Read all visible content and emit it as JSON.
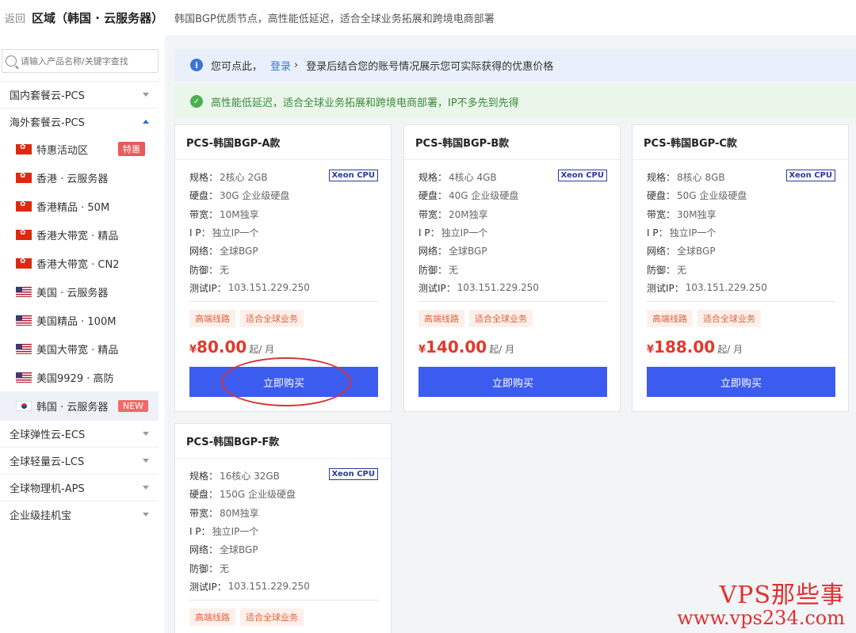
{
  "header": {
    "back_label": "返回",
    "title": "区域（韩国 · 云服务器）",
    "description": "韩国BGP优质节点，高性能低延迟，适合全球业务拓展和跨境电商部署"
  },
  "sidebar": {
    "search_placeholder": "请输入产品名称/关键字查找",
    "groups_top": [
      {
        "label": "国内套餐云-PCS",
        "expanded": false
      },
      {
        "label": "海外套餐云-PCS",
        "expanded": true
      }
    ],
    "sub_items": [
      {
        "label": "特惠活动区",
        "flag": "hk",
        "badge": "特惠"
      },
      {
        "label": "香港 · 云服务器",
        "flag": "hk"
      },
      {
        "label": "香港精品 · 50M",
        "flag": "hk"
      },
      {
        "label": "香港大带宽 · 精品",
        "flag": "hk"
      },
      {
        "label": "香港大带宽 · CN2",
        "flag": "hk"
      },
      {
        "label": "美国 · 云服务器",
        "flag": "us"
      },
      {
        "label": "美国精品 · 100M",
        "flag": "us"
      },
      {
        "label": "美国大带宽 · 精品",
        "flag": "us"
      },
      {
        "label": "美国9929 · 高防",
        "flag": "us"
      },
      {
        "label": "韩国 · 云服务器",
        "flag": "kr",
        "badge": "NEW",
        "active": true
      }
    ],
    "groups_bottom": [
      {
        "label": "全球弹性云-ECS"
      },
      {
        "label": "全球轻量云-LCS"
      },
      {
        "label": "全球物理机-APS"
      },
      {
        "label": "企业级挂机宝"
      }
    ]
  },
  "notices": {
    "info_prefix": "您可点此，",
    "login_link": "登录",
    "chevron": "›",
    "info_suffix": "登录后结合您的账号情况展示您可实际获得的优惠价格",
    "ok_text": "高性能低延迟，适合全球业务拓展和跨境电商部署，IP不多先到先得"
  },
  "labels": {
    "spec": "规格：",
    "disk": "硬盘：",
    "bandwidth": "带宽：",
    "ip": "I P：",
    "network": "网络：",
    "defense": "防御：",
    "test_ip": "测试IP：",
    "cpu_badge": "Xeon CPU",
    "tag1": "高端线路",
    "tag2": "适合全球业务",
    "currency": "¥",
    "unit": "起/ 月",
    "buy": "立即购买"
  },
  "products": [
    {
      "name": "PCS-韩国BGP-A款",
      "spec": "2核心 2GB",
      "disk": "30G 企业级硬盘",
      "bandwidth": "10M独享",
      "ip": "独立IP一个",
      "network": "全球BGP",
      "defense": "无",
      "test_ip": "103.151.229.250",
      "price": "80.00"
    },
    {
      "name": "PCS-韩国BGP-B款",
      "spec": "4核心 4GB",
      "disk": "40G 企业级硬盘",
      "bandwidth": "20M独享",
      "ip": "独立IP一个",
      "network": "全球BGP",
      "defense": "无",
      "test_ip": "103.151.229.250",
      "price": "140.00"
    },
    {
      "name": "PCS-韩国BGP-C款",
      "spec": "8核心 8GB",
      "disk": "50G 企业级硬盘",
      "bandwidth": "30M独享",
      "ip": "独立IP一个",
      "network": "全球BGP",
      "defense": "无",
      "test_ip": "103.151.229.250",
      "price": "188.00"
    },
    {
      "name": "PCS-韩国BGP-F款",
      "spec": "16核心 32GB",
      "disk": "150G 企业级硬盘",
      "bandwidth": "80M独享",
      "ip": "独立IP一个",
      "network": "全球BGP",
      "defense": "无",
      "test_ip": "103.151.229.250",
      "price": ""
    }
  ],
  "watermark": {
    "line1": "VPS那些事",
    "line2": "www.vps234.com"
  }
}
